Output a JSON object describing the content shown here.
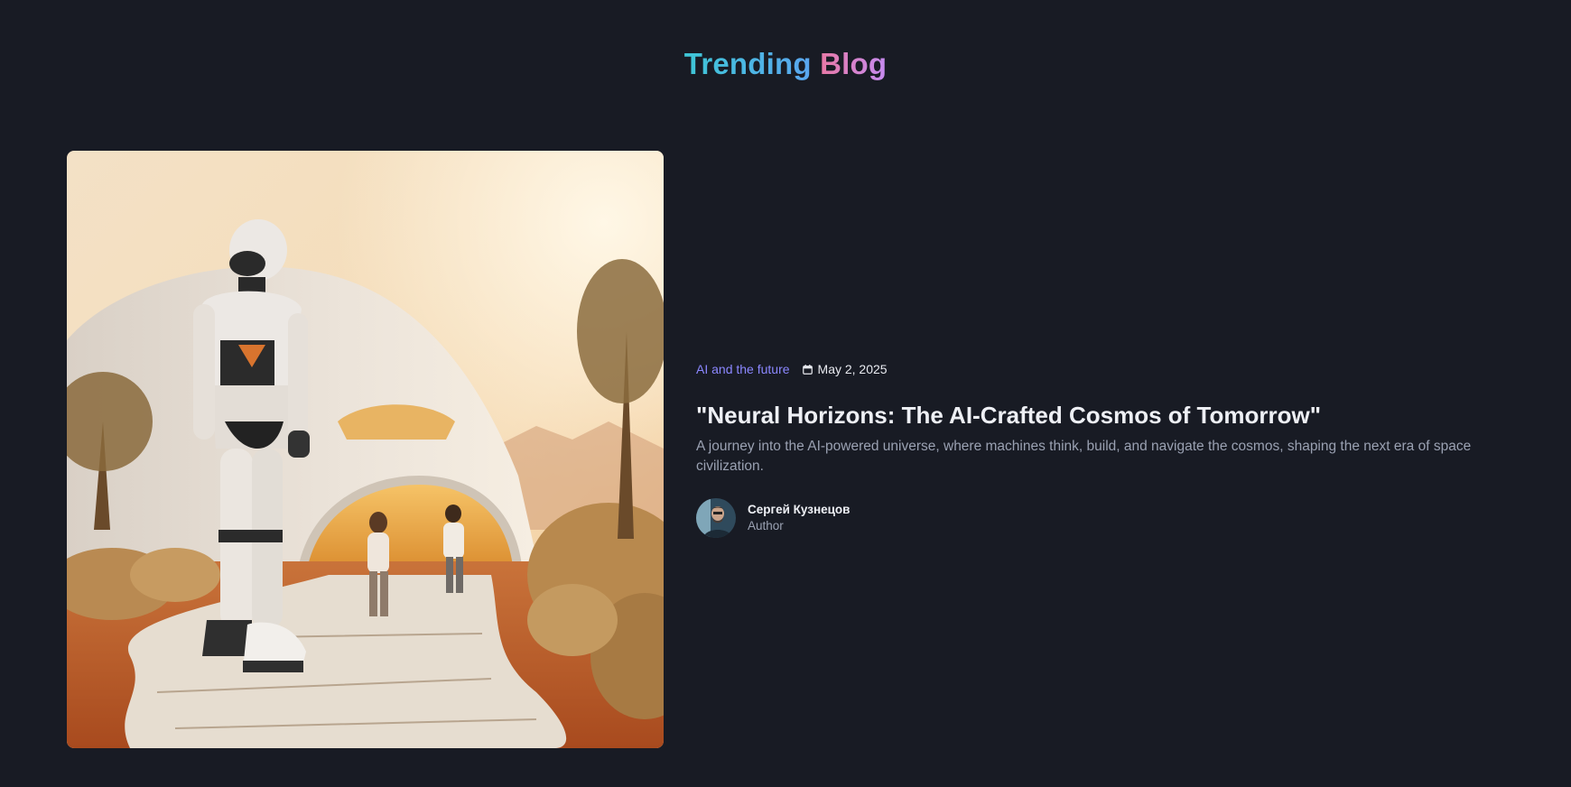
{
  "header": {
    "title_part1": "Trending",
    "title_part2": "Blog"
  },
  "article": {
    "image": "robot-and-children-walking-to-dome-house-illustration",
    "category": "AI and the future",
    "date_icon": "calendar-icon",
    "date": "May 2, 2025",
    "title": "\"Neural Horizons: The AI-Crafted Cosmos of Tomorrow\"",
    "excerpt": "A journey into the AI-powered universe, where machines think, build, and navigate the cosmos, shaping the next era of space civilization.",
    "author": {
      "name": "Сергей Кузнецов",
      "role": "Author"
    }
  },
  "colors": {
    "background": "#181b24",
    "category": "#8b87ff",
    "muted_text": "#9aa1b2",
    "title_gradient_1": [
      "#3ec6d6",
      "#5aa6f0"
    ],
    "title_gradient_2": [
      "#e879a6",
      "#c58bf0"
    ]
  }
}
